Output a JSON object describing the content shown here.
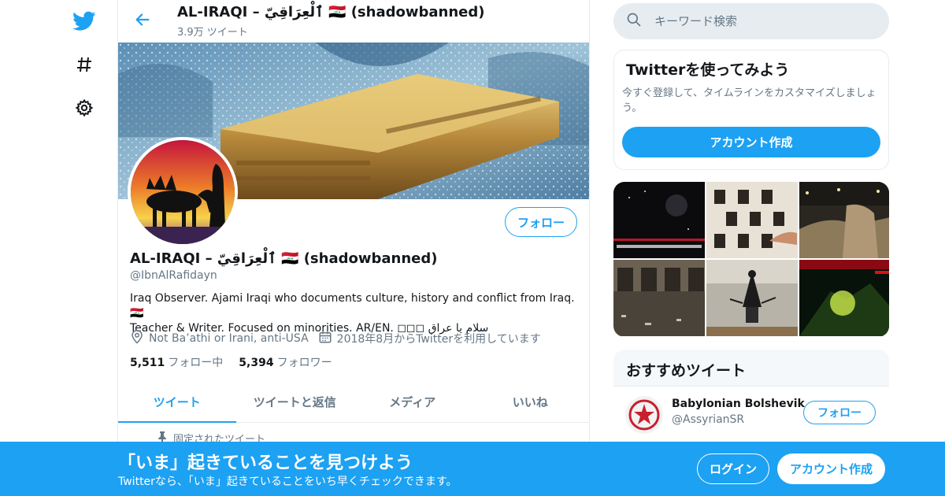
{
  "header": {
    "title": "AL-IRAQI – ٱلْعِرَاقِيّ 🇮🇶 (shadowbanned)",
    "tweet_count": "3.9万 ツイート"
  },
  "profile": {
    "follow_label": "フォロー",
    "display_name": "AL-IRAQI – ٱلْعِرَاقِيّ 🇮🇶 (shadowbanned)",
    "handle": "@IbnAlRafidayn",
    "bio_line1": "Iraq Observer. Ajami Iraqi who documents culture, history and conflict from Iraq.🇮🇶",
    "bio_line2": " Teacher & Writer. Focused on minorities. AR/EN. ◻◻◻ سلام يا عراق",
    "location": "Not Ba’athi or Irani, anti-USA",
    "joined": "2018年8月からTwitterを利用しています",
    "following_count": "5,511",
    "following_label": "フォロー中",
    "followers_count": "5,394",
    "followers_label": "フォロワー"
  },
  "tabs": [
    {
      "label": "ツイート",
      "active": true
    },
    {
      "label": "ツイートと返信",
      "active": false
    },
    {
      "label": "メディア",
      "active": false
    },
    {
      "label": "いいね",
      "active": false
    }
  ],
  "pinned_label": "固定されたツイート",
  "search": {
    "placeholder": "キーワード検索"
  },
  "try_card": {
    "title": "Twitterを使ってみよう",
    "description": "今すぐ登録して、タイムラインをカスタマイズしましょう。",
    "button": "アカウント作成"
  },
  "recommended": {
    "title": "おすすめツイート",
    "name": "Babylonian Bolshevik",
    "handle": "@AssyrianSR",
    "follow_label": "フォロー"
  },
  "bottom_bar": {
    "title": "「いま」起きていることを見つけよう",
    "subtitle": "Twitterなら、「いま」起きていることをいち早くチェックできます。",
    "login": "ログイン",
    "signup": "アカウント作成"
  },
  "colors": {
    "accent": "#1da1f2",
    "secondary_text": "#657786"
  }
}
